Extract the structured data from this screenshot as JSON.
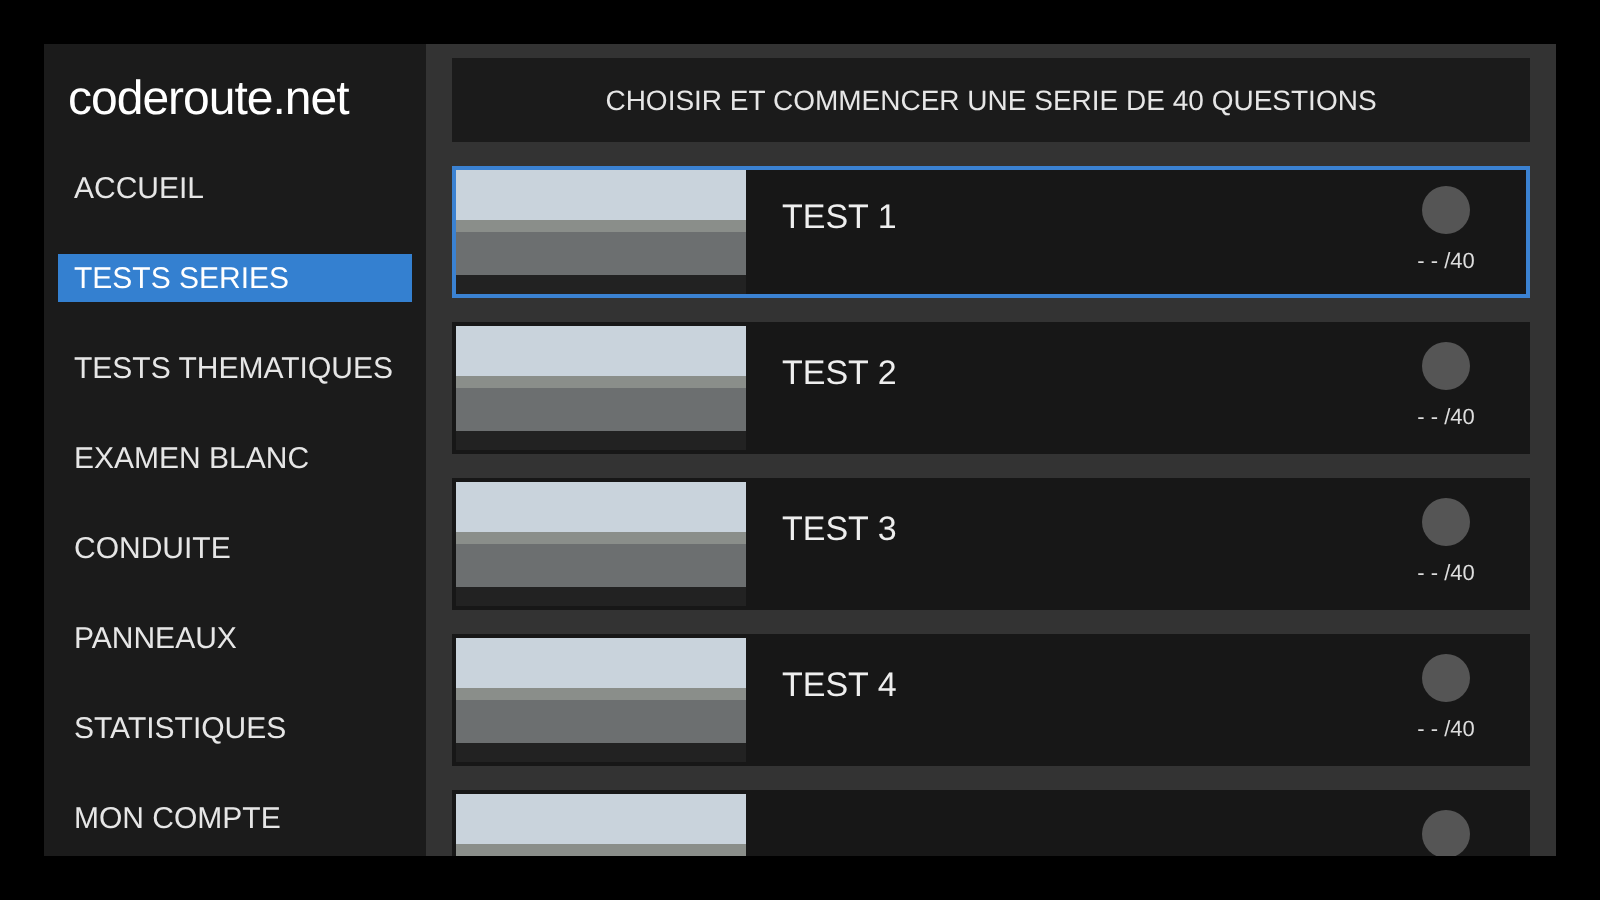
{
  "logo": {
    "text": "coderoute.net"
  },
  "menu": [
    {
      "label": "ACCUEIL",
      "selected": false
    },
    {
      "label": "TESTS SERIES",
      "selected": true
    },
    {
      "label": "TESTS THEMATIQUES",
      "selected": false
    },
    {
      "label": "EXAMEN BLANC",
      "selected": false
    },
    {
      "label": "CONDUITE",
      "selected": false
    },
    {
      "label": "PANNEAUX",
      "selected": false
    },
    {
      "label": "STATISTIQUES",
      "selected": false
    },
    {
      "label": "MON COMPTE",
      "selected": false
    }
  ],
  "header": "CHOISIR ET COMMENCER UNE SERIE DE 40 QUESTIONS",
  "tests": [
    {
      "title": "TEST 1",
      "score": "- - /40",
      "selected": true
    },
    {
      "title": "TEST 2",
      "score": "- - /40",
      "selected": false
    },
    {
      "title": "TEST 3",
      "score": "- - /40",
      "selected": false
    },
    {
      "title": "TEST 4",
      "score": "- - /40",
      "selected": false
    }
  ],
  "more_below": true
}
